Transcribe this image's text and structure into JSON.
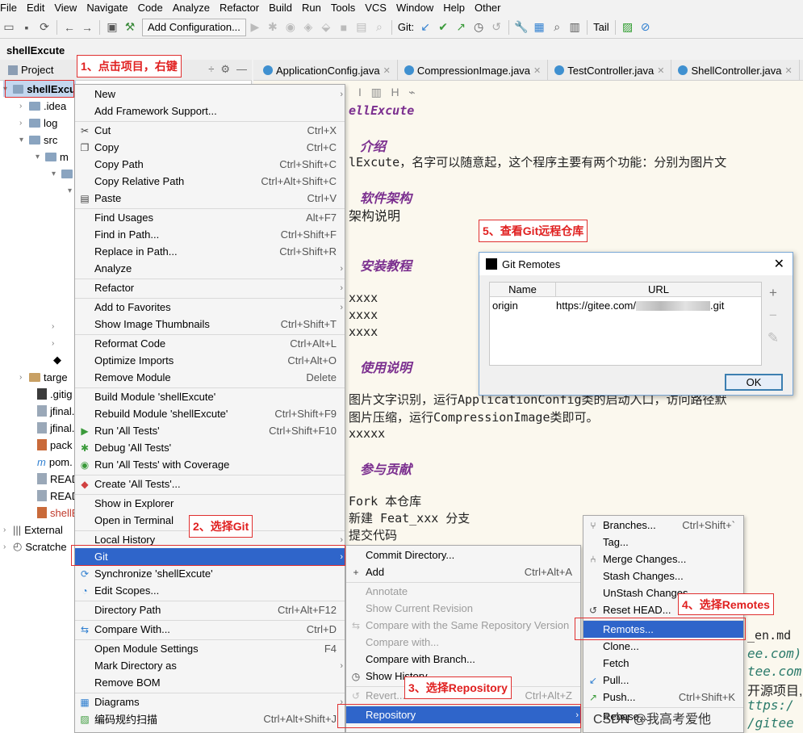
{
  "menubar": [
    "File",
    "Edit",
    "View",
    "Navigate",
    "Code",
    "Analyze",
    "Refactor",
    "Build",
    "Run",
    "Tools",
    "VCS",
    "Window",
    "Help",
    "Other"
  ],
  "toolbar": {
    "config_label": "Add Configuration...",
    "git_label": "Git:",
    "tail_label": "Tail"
  },
  "breadcrumb": "shellExcute",
  "project_panel": {
    "title": "Project",
    "tree": [
      {
        "label": "shellExcu",
        "icon": "folder"
      },
      {
        "label": ".idea",
        "icon": "folder"
      },
      {
        "label": "log",
        "icon": "folder"
      },
      {
        "label": "src",
        "icon": "folder"
      },
      {
        "label": "m",
        "icon": "folder"
      },
      {
        "label": "targe",
        "icon": "folder"
      },
      {
        "label": ".gitig",
        "icon": "file"
      },
      {
        "label": "jfinal.",
        "icon": "file"
      },
      {
        "label": "jfinal.",
        "icon": "file"
      },
      {
        "label": "pack",
        "icon": "file"
      },
      {
        "label": "pom.",
        "icon": "file"
      },
      {
        "label": "READ",
        "icon": "file"
      },
      {
        "label": "READ",
        "icon": "file"
      },
      {
        "label": "shellE",
        "icon": "file"
      },
      {
        "label": "External",
        "icon": "library"
      },
      {
        "label": "Scratche",
        "icon": "folder"
      }
    ]
  },
  "tabs": [
    "ApplicationConfig.java",
    "CompressionImage.java",
    "TestController.java",
    "ShellController.java"
  ],
  "editor_lines": {
    "title": "ellExcute",
    "h_intro": "介绍",
    "intro_text": "lExcute，名字可以随意起，这个程序主要有两个功能：分别为图片文",
    "h_arch": "软件架构",
    "arch_text": "架构说明",
    "h_install": "安装教程",
    "x1": "xxxx",
    "x2": "xxxx",
    "x3": "xxxx",
    "h_usage": "使用说明",
    "usage1": "图片文字识别，运行ApplicationConfig类的启动入口，访问路径默",
    "usage2": "图片压缩，运行CompressionImage类即可。",
    "usage3": "xxxxx",
    "h_contrib": "参与贡献",
    "c1": "Fork 本仓库",
    "c2": "新建 Feat_xxx 分支",
    "c3": "提交代码",
    "r1": "_en.md",
    "r2": "ee.com)",
    "r3": "tee.com",
    "r4": "开源项目,",
    "r5": "ttps:/",
    "r6": "/gitee"
  },
  "context_menu": [
    {
      "label": "New",
      "shortcut": "",
      "submenu": true
    },
    {
      "label": "Add Framework Support...",
      "shortcut": ""
    },
    {
      "label": "Cut",
      "shortcut": "Ctrl+X",
      "icon": "scissors-icon"
    },
    {
      "label": "Copy",
      "shortcut": "Ctrl+C",
      "icon": "copy-icon"
    },
    {
      "label": "Copy Path",
      "shortcut": "Ctrl+Shift+C"
    },
    {
      "label": "Copy Relative Path",
      "shortcut": "Ctrl+Alt+Shift+C"
    },
    {
      "label": "Paste",
      "shortcut": "Ctrl+V",
      "icon": "paste-icon"
    },
    {
      "label": "Find Usages",
      "shortcut": "Alt+F7"
    },
    {
      "label": "Find in Path...",
      "shortcut": "Ctrl+Shift+F"
    },
    {
      "label": "Replace in Path...",
      "shortcut": "Ctrl+Shift+R"
    },
    {
      "label": "Analyze",
      "shortcut": "",
      "submenu": true
    },
    {
      "label": "Refactor",
      "shortcut": "",
      "submenu": true
    },
    {
      "label": "Add to Favorites",
      "shortcut": "",
      "submenu": true
    },
    {
      "label": "Show Image Thumbnails",
      "shortcut": "Ctrl+Shift+T"
    },
    {
      "label": "Reformat Code",
      "shortcut": "Ctrl+Alt+L"
    },
    {
      "label": "Optimize Imports",
      "shortcut": "Ctrl+Alt+O"
    },
    {
      "label": "Remove Module",
      "shortcut": "Delete"
    },
    {
      "label": "Build Module 'shellExcute'",
      "shortcut": ""
    },
    {
      "label": "Rebuild Module 'shellExcute'",
      "shortcut": "Ctrl+Shift+F9"
    },
    {
      "label": "Run 'All Tests'",
      "shortcut": "Ctrl+Shift+F10",
      "icon": "run-icon"
    },
    {
      "label": "Debug 'All Tests'",
      "shortcut": "",
      "icon": "debug-icon"
    },
    {
      "label": "Run 'All Tests' with Coverage",
      "shortcut": "",
      "icon": "coverage-icon"
    },
    {
      "label": "Create 'All Tests'...",
      "shortcut": "",
      "icon": "create-test-icon"
    },
    {
      "label": "Show in Explorer",
      "shortcut": ""
    },
    {
      "label": "Open in Terminal",
      "shortcut": ""
    },
    {
      "label": "Local History",
      "shortcut": "",
      "submenu": true
    },
    {
      "label": "Git",
      "shortcut": "",
      "submenu": true,
      "highlighted": true
    },
    {
      "label": "Synchronize 'shellExcute'",
      "shortcut": "",
      "icon": "sync-icon"
    },
    {
      "label": "Edit Scopes...",
      "shortcut": "",
      "icon": "scope-icon"
    },
    {
      "label": "Directory Path",
      "shortcut": "Ctrl+Alt+F12"
    },
    {
      "label": "Compare With...",
      "shortcut": "Ctrl+D",
      "icon": "compare-icon"
    },
    {
      "label": "Open Module Settings",
      "shortcut": "F4"
    },
    {
      "label": "Mark Directory as",
      "shortcut": "",
      "submenu": true
    },
    {
      "label": "Remove BOM",
      "shortcut": ""
    },
    {
      "label": "Diagrams",
      "shortcut": "",
      "submenu": true,
      "icon": "diagram-icon"
    },
    {
      "label": "编码规约扫描",
      "shortcut": "Ctrl+Alt+Shift+J",
      "icon": "scan-icon"
    }
  ],
  "git_submenu": [
    {
      "label": "Commit Directory...",
      "shortcut": ""
    },
    {
      "label": "Add",
      "shortcut": "Ctrl+Alt+A",
      "icon": "plus-icon"
    },
    {
      "label": "Annotate",
      "shortcut": "",
      "disabled": true
    },
    {
      "label": "Show Current Revision",
      "shortcut": "",
      "disabled": true
    },
    {
      "label": "Compare with the Same Repository Version",
      "shortcut": "",
      "disabled": true
    },
    {
      "label": "Compare with...",
      "shortcut": "",
      "disabled": true
    },
    {
      "label": "Compare with Branch...",
      "shortcut": ""
    },
    {
      "label": "Show History",
      "shortcut": "",
      "icon": "history-icon"
    },
    {
      "label": "Revert...",
      "shortcut": "Ctrl+Alt+Z",
      "disabled": true
    },
    {
      "label": "Repository",
      "shortcut": "",
      "submenu": true,
      "highlighted": true
    }
  ],
  "repo_submenu": [
    {
      "label": "Branches...",
      "shortcut": "Ctrl+Shift+`",
      "icon": "branch-icon"
    },
    {
      "label": "Tag...",
      "shortcut": ""
    },
    {
      "label": "Merge Changes...",
      "shortcut": "",
      "icon": "merge-icon"
    },
    {
      "label": "Stash Changes...",
      "shortcut": ""
    },
    {
      "label": "UnStash Changes...",
      "shortcut": ""
    },
    {
      "label": "Reset HEAD...",
      "shortcut": "",
      "icon": "reset-icon"
    },
    {
      "label": "Remotes...",
      "shortcut": "",
      "highlighted": true
    },
    {
      "label": "Clone...",
      "shortcut": ""
    },
    {
      "label": "Fetch",
      "shortcut": ""
    },
    {
      "label": "Pull...",
      "shortcut": "",
      "icon": "pull-icon"
    },
    {
      "label": "Push...",
      "shortcut": "Ctrl+Shift+K",
      "icon": "push-icon"
    },
    {
      "label": "Rebase...",
      "shortcut": ""
    }
  ],
  "dialog": {
    "title": "Git Remotes",
    "columns": [
      "Name",
      "URL"
    ],
    "rows": [
      {
        "name": "origin",
        "url": "https://gitee.com/",
        "url_suffix": ".git"
      }
    ],
    "ok_label": "OK"
  },
  "annotations": {
    "step1": "1、点击项目，右键",
    "step2": "2、选择Git",
    "step3": "3、选择Repository",
    "step4": "4、选择Remotes",
    "step5": "5、查看Git远程仓库"
  },
  "watermark": "CSDN @我高考爱他"
}
